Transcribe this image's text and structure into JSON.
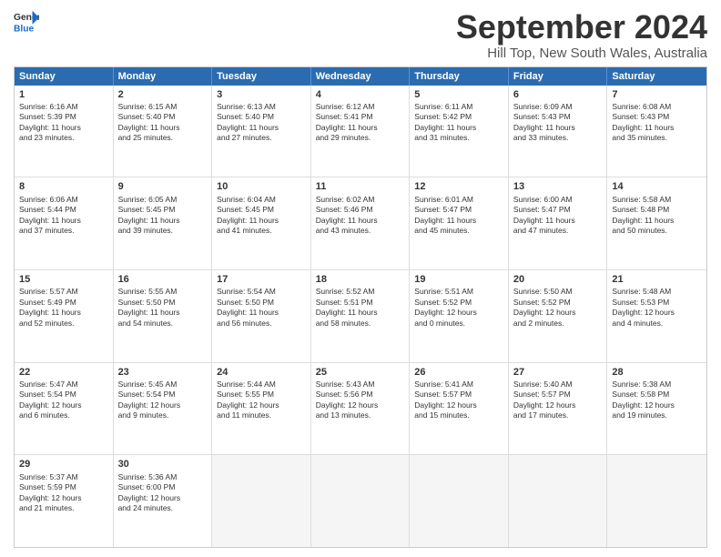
{
  "logo": {
    "line1": "General",
    "line2": "Blue"
  },
  "title": "September 2024",
  "location": "Hill Top, New South Wales, Australia",
  "headers": [
    "Sunday",
    "Monday",
    "Tuesday",
    "Wednesday",
    "Thursday",
    "Friday",
    "Saturday"
  ],
  "rows": [
    [
      {
        "day": "1",
        "text": "Sunrise: 6:16 AM\nSunset: 5:39 PM\nDaylight: 11 hours\nand 23 minutes."
      },
      {
        "day": "2",
        "text": "Sunrise: 6:15 AM\nSunset: 5:40 PM\nDaylight: 11 hours\nand 25 minutes."
      },
      {
        "day": "3",
        "text": "Sunrise: 6:13 AM\nSunset: 5:40 PM\nDaylight: 11 hours\nand 27 minutes."
      },
      {
        "day": "4",
        "text": "Sunrise: 6:12 AM\nSunset: 5:41 PM\nDaylight: 11 hours\nand 29 minutes."
      },
      {
        "day": "5",
        "text": "Sunrise: 6:11 AM\nSunset: 5:42 PM\nDaylight: 11 hours\nand 31 minutes."
      },
      {
        "day": "6",
        "text": "Sunrise: 6:09 AM\nSunset: 5:43 PM\nDaylight: 11 hours\nand 33 minutes."
      },
      {
        "day": "7",
        "text": "Sunrise: 6:08 AM\nSunset: 5:43 PM\nDaylight: 11 hours\nand 35 minutes."
      }
    ],
    [
      {
        "day": "8",
        "text": "Sunrise: 6:06 AM\nSunset: 5:44 PM\nDaylight: 11 hours\nand 37 minutes."
      },
      {
        "day": "9",
        "text": "Sunrise: 6:05 AM\nSunset: 5:45 PM\nDaylight: 11 hours\nand 39 minutes."
      },
      {
        "day": "10",
        "text": "Sunrise: 6:04 AM\nSunset: 5:45 PM\nDaylight: 11 hours\nand 41 minutes."
      },
      {
        "day": "11",
        "text": "Sunrise: 6:02 AM\nSunset: 5:46 PM\nDaylight: 11 hours\nand 43 minutes."
      },
      {
        "day": "12",
        "text": "Sunrise: 6:01 AM\nSunset: 5:47 PM\nDaylight: 11 hours\nand 45 minutes."
      },
      {
        "day": "13",
        "text": "Sunrise: 6:00 AM\nSunset: 5:47 PM\nDaylight: 11 hours\nand 47 minutes."
      },
      {
        "day": "14",
        "text": "Sunrise: 5:58 AM\nSunset: 5:48 PM\nDaylight: 11 hours\nand 50 minutes."
      }
    ],
    [
      {
        "day": "15",
        "text": "Sunrise: 5:57 AM\nSunset: 5:49 PM\nDaylight: 11 hours\nand 52 minutes."
      },
      {
        "day": "16",
        "text": "Sunrise: 5:55 AM\nSunset: 5:50 PM\nDaylight: 11 hours\nand 54 minutes."
      },
      {
        "day": "17",
        "text": "Sunrise: 5:54 AM\nSunset: 5:50 PM\nDaylight: 11 hours\nand 56 minutes."
      },
      {
        "day": "18",
        "text": "Sunrise: 5:52 AM\nSunset: 5:51 PM\nDaylight: 11 hours\nand 58 minutes."
      },
      {
        "day": "19",
        "text": "Sunrise: 5:51 AM\nSunset: 5:52 PM\nDaylight: 12 hours\nand 0 minutes."
      },
      {
        "day": "20",
        "text": "Sunrise: 5:50 AM\nSunset: 5:52 PM\nDaylight: 12 hours\nand 2 minutes."
      },
      {
        "day": "21",
        "text": "Sunrise: 5:48 AM\nSunset: 5:53 PM\nDaylight: 12 hours\nand 4 minutes."
      }
    ],
    [
      {
        "day": "22",
        "text": "Sunrise: 5:47 AM\nSunset: 5:54 PM\nDaylight: 12 hours\nand 6 minutes."
      },
      {
        "day": "23",
        "text": "Sunrise: 5:45 AM\nSunset: 5:54 PM\nDaylight: 12 hours\nand 9 minutes."
      },
      {
        "day": "24",
        "text": "Sunrise: 5:44 AM\nSunset: 5:55 PM\nDaylight: 12 hours\nand 11 minutes."
      },
      {
        "day": "25",
        "text": "Sunrise: 5:43 AM\nSunset: 5:56 PM\nDaylight: 12 hours\nand 13 minutes."
      },
      {
        "day": "26",
        "text": "Sunrise: 5:41 AM\nSunset: 5:57 PM\nDaylight: 12 hours\nand 15 minutes."
      },
      {
        "day": "27",
        "text": "Sunrise: 5:40 AM\nSunset: 5:57 PM\nDaylight: 12 hours\nand 17 minutes."
      },
      {
        "day": "28",
        "text": "Sunrise: 5:38 AM\nSunset: 5:58 PM\nDaylight: 12 hours\nand 19 minutes."
      }
    ],
    [
      {
        "day": "29",
        "text": "Sunrise: 5:37 AM\nSunset: 5:59 PM\nDaylight: 12 hours\nand 21 minutes."
      },
      {
        "day": "30",
        "text": "Sunrise: 5:36 AM\nSunset: 6:00 PM\nDaylight: 12 hours\nand 24 minutes."
      },
      {
        "day": "",
        "text": ""
      },
      {
        "day": "",
        "text": ""
      },
      {
        "day": "",
        "text": ""
      },
      {
        "day": "",
        "text": ""
      },
      {
        "day": "",
        "text": ""
      }
    ]
  ]
}
